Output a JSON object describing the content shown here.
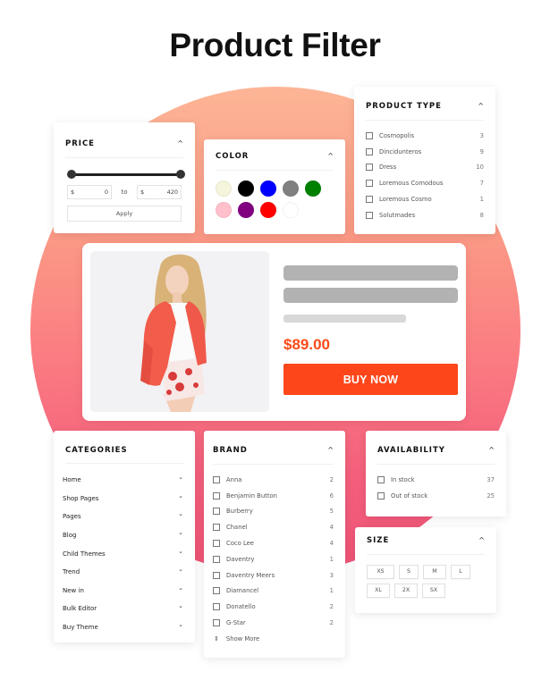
{
  "title": "Product Filter",
  "theme": {
    "accent": "#fd461a",
    "price_color": "#fa4b18",
    "circle_gradient": [
      "#fdb596",
      "#ef5477"
    ]
  },
  "price": {
    "title": "PRICE",
    "currency": "$",
    "min_value": "0",
    "max_value": "420",
    "to_label": "to",
    "apply_label": "Apply",
    "slider_range": {
      "min_fraction": 0,
      "max_fraction": 1
    },
    "caret": "^"
  },
  "color": {
    "title": "COLOR",
    "caret": "^",
    "swatches": [
      {
        "name": "beige",
        "hex": "#f5f5dc"
      },
      {
        "name": "black",
        "hex": "#000000"
      },
      {
        "name": "blue",
        "hex": "#0000ff"
      },
      {
        "name": "gray",
        "hex": "#808080"
      },
      {
        "name": "green",
        "hex": "#008000"
      },
      {
        "name": "pink",
        "hex": "#ffc0cb"
      },
      {
        "name": "purple",
        "hex": "#800080"
      },
      {
        "name": "red",
        "hex": "#ff0000"
      },
      {
        "name": "white",
        "hex": "#ffffff"
      }
    ]
  },
  "product_type": {
    "title": "PRODUCT TYPE",
    "caret": "^",
    "items": [
      {
        "label": "Cosmopolis",
        "count": "3"
      },
      {
        "label": "Dincidunteros",
        "count": "9"
      },
      {
        "label": "Dress",
        "count": "10"
      },
      {
        "label": "Loremous Comodous",
        "count": "7"
      },
      {
        "label": "Loremous Cosmo",
        "count": "1"
      },
      {
        "label": "Solutmades",
        "count": "8"
      }
    ]
  },
  "product_card": {
    "price": "$89.00",
    "buy_label": "BUY NOW"
  },
  "categories": {
    "title": "CATEGORIES",
    "chevron": "⌄",
    "items": [
      {
        "label": "Home"
      },
      {
        "label": "Shop Pages"
      },
      {
        "label": "Pages"
      },
      {
        "label": "Blog"
      },
      {
        "label": "Child Themes"
      },
      {
        "label": "Trend"
      },
      {
        "label": "New in"
      },
      {
        "label": "Bulk Editor"
      },
      {
        "label": "Buy Theme"
      }
    ]
  },
  "brand": {
    "title": "BRAND",
    "caret": "^",
    "items": [
      {
        "label": "Anna",
        "count": "2"
      },
      {
        "label": "Benjamin Button",
        "count": "6"
      },
      {
        "label": "Burberry",
        "count": "5"
      },
      {
        "label": "Chanel",
        "count": "4"
      },
      {
        "label": "Coco Lee",
        "count": "4"
      },
      {
        "label": "Daventry",
        "count": "1"
      },
      {
        "label": "Daventry Meers",
        "count": "3"
      },
      {
        "label": "Diamancel",
        "count": "1"
      },
      {
        "label": "Donatello",
        "count": "2"
      },
      {
        "label": "G-Star",
        "count": "2"
      }
    ],
    "show_more_label": "Show More",
    "show_more_icon": "⇕"
  },
  "availability": {
    "title": "AVAILABILITY",
    "caret": "^",
    "items": [
      {
        "label": "In stock",
        "count": "37"
      },
      {
        "label": "Out of stock",
        "count": "25"
      }
    ]
  },
  "size": {
    "title": "SIZE",
    "caret": "^",
    "rows": [
      [
        "XS",
        "S",
        "M",
        "L"
      ],
      [
        "XL",
        "2X",
        "SX"
      ]
    ]
  }
}
